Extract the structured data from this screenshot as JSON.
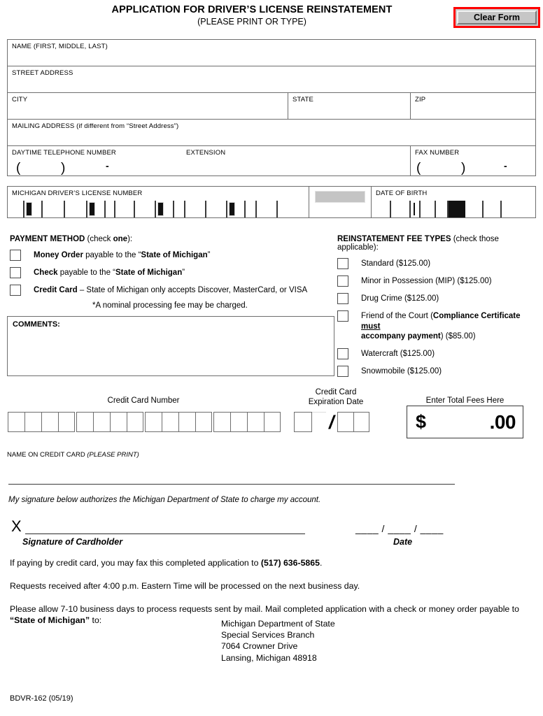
{
  "header": {
    "title": "APPLICATION FOR DRIVER’S LICENSE REINSTATEMENT",
    "subtitle": "(PLEASE PRINT OR TYPE)",
    "clear_form_label": "Clear Form",
    "clear_form_border_color": "#ff0000",
    "clear_form_face_color": "#c6c6c6"
  },
  "fields": {
    "name": "NAME (FIRST, MIDDLE, LAST)",
    "street_address": "STREET ADDRESS",
    "city": "CITY",
    "state": "STATE",
    "zip": "ZIP",
    "mailing_address": "MAILING ADDRESS (if different from “Street Address”)",
    "daytime_telephone": "DAYTIME TELEPHONE NUMBER",
    "extension": "EXTENSION",
    "fax_number": "FAX NUMBER",
    "paren_open": "(",
    "paren_close": ")",
    "dash": "-",
    "license_number": "MICHIGAN DRIVER’S LICENSE NUMBER",
    "date_of_birth": "DATE OF BIRTH"
  },
  "payment_method": {
    "heading_bold": "PAYMENT METHOD",
    "heading_rest_pre": " (check ",
    "heading_rest_bold": "one",
    "heading_rest_post": "):",
    "options": [
      {
        "bold": "Money Order",
        "pre": "",
        "mid": " payable to the “",
        "strong": "State of Michigan",
        "post": "”"
      },
      {
        "bold": "Check",
        "pre": "",
        "mid": " payable to the “",
        "strong": "State of Michigan",
        "post": "”"
      },
      {
        "bold": "Credit Card",
        "pre": "",
        "mid": " – State of Michigan only accepts Discover, MasterCard, or VISA",
        "strong": "",
        "post": ""
      }
    ],
    "nominal_fee_note": "*A nominal processing fee may be charged."
  },
  "fee_types": {
    "heading_bold": "REINSTATEMENT FEE TYPES",
    "heading_rest": " (check those applicable):",
    "options": [
      {
        "text": "Standard  ($125.00)"
      },
      {
        "text": "Minor in Possession (MIP) ($125.00)"
      },
      {
        "text": "Drug Crime ($125.00)"
      },
      {
        "text": "",
        "rich": true,
        "part1": "Friend of the Court (",
        "bold1": "Compliance Certificate ",
        "underline_bold": "must",
        "bold2": "accompany payment",
        "part2": ") ($85.00)"
      },
      {
        "text": "Watercraft  ($125.00)"
      },
      {
        "text": "Snowmobile ($125.00)"
      }
    ]
  },
  "comments": {
    "label": "COMMENTS:",
    "value": ""
  },
  "credit_card": {
    "number_label": "Credit Card Number",
    "expiration_label_line1": "Credit Card",
    "expiration_label_line2": "Expiration Date",
    "total_label": "Enter Total Fees Here",
    "dollar_sign": "$",
    "cents": ".00",
    "slash": "/",
    "name_on_card_label_plain": "NAME ON CREDIT CARD ",
    "name_on_card_label_italic": "(PLEASE PRINT)"
  },
  "signature": {
    "authorization": "My signature below authorizes the Michigan Department of State to charge my account.",
    "x_mark": "X",
    "caption": "Signature of Cardholder",
    "date_marks": "____ / ____ / ____",
    "date_caption": "Date"
  },
  "instructions": {
    "fax_pre": "If paying by credit card, you may fax this completed application to ",
    "fax_number": "(517) 636-5865",
    "fax_post": ".",
    "cutoff": "Requests received after 4:00 p.m. Eastern Time will be processed on the next business day.",
    "mail_pre": "Please allow 7-10 business days to process requests sent by mail.  Mail completed application with a check or money order payable to ",
    "mail_bold": "“State of Michigan”",
    "mail_post": " to:"
  },
  "mailing_address_block": {
    "line1": "Michigan Department of State",
    "line2": "Special Services Branch",
    "line3": "7064 Crowner Drive",
    "line4": "Lansing, Michigan 48918"
  },
  "footer": {
    "form_code": "BDVR-162 (05/19)"
  }
}
